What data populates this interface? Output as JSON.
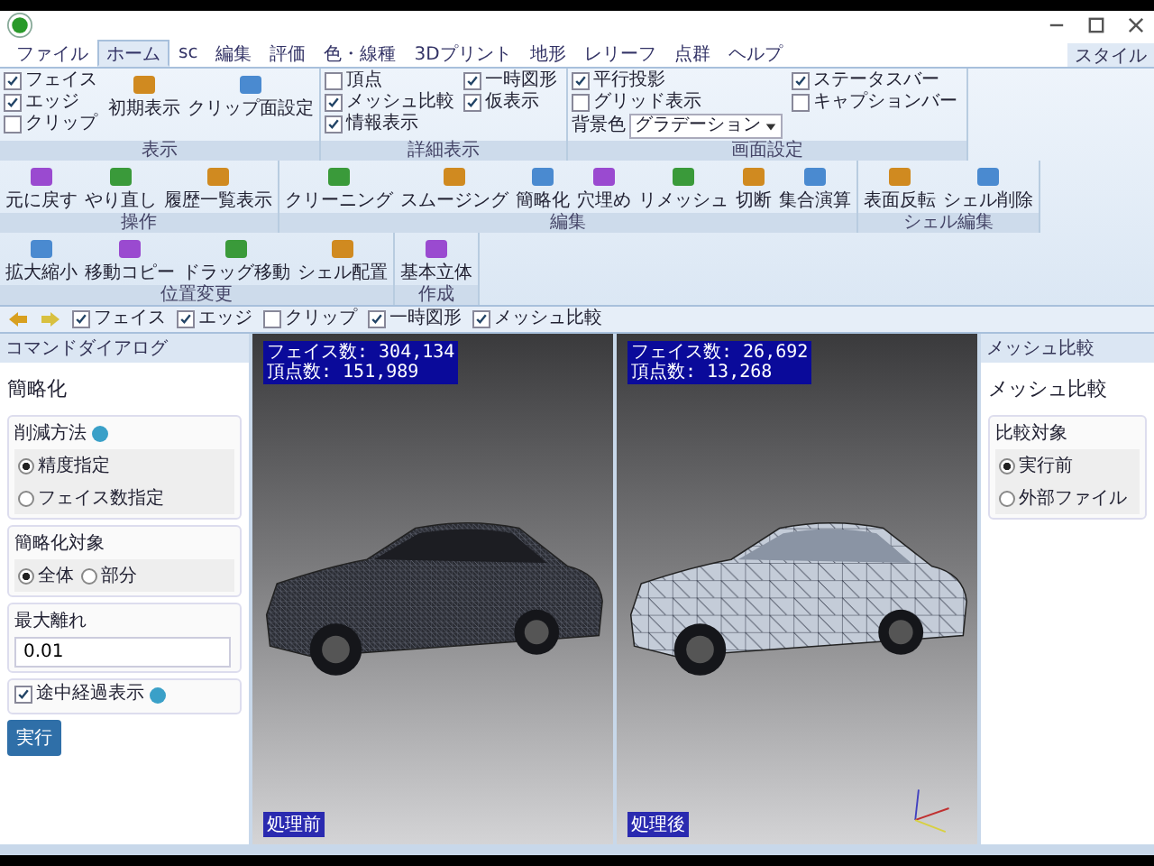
{
  "window": {
    "style_menu": "スタイル"
  },
  "tabs": [
    {
      "label": "ファイル",
      "selected": false
    },
    {
      "label": "ホーム",
      "selected": true
    },
    {
      "label": "sc",
      "selected": false
    },
    {
      "label": "編集",
      "selected": false
    },
    {
      "label": "評価",
      "selected": false
    },
    {
      "label": "色・線種",
      "selected": false
    },
    {
      "label": "3Dプリント",
      "selected": false
    },
    {
      "label": "地形",
      "selected": false
    },
    {
      "label": "レリーフ",
      "selected": false
    },
    {
      "label": "点群",
      "selected": false
    },
    {
      "label": "ヘルプ",
      "selected": false
    }
  ],
  "ribbon_groups": [
    {
      "title": "表示",
      "items": [
        {
          "kind": "check",
          "label": "フェイス",
          "checked": true
        },
        {
          "kind": "check",
          "label": "エッジ",
          "checked": true
        },
        {
          "kind": "check",
          "label": "クリップ",
          "checked": false
        },
        {
          "kind": "button",
          "label": "初期表示"
        },
        {
          "kind": "button",
          "label": "クリップ面設定"
        }
      ]
    },
    {
      "title": "詳細表示",
      "items": [
        {
          "kind": "check",
          "label": "頂点",
          "checked": false
        },
        {
          "kind": "check",
          "label": "メッシュ比較",
          "checked": true
        },
        {
          "kind": "check",
          "label": "情報表示",
          "checked": true
        },
        {
          "kind": "check",
          "label": "一時図形",
          "checked": true
        },
        {
          "kind": "check",
          "label": "仮表示",
          "checked": true
        }
      ]
    },
    {
      "title": "画面設定",
      "items": [
        {
          "kind": "check",
          "label": "平行投影",
          "checked": true
        },
        {
          "kind": "check",
          "label": "グリッド表示",
          "checked": false
        },
        {
          "kind": "select",
          "label": "背景色",
          "value": "グラデーション"
        },
        {
          "kind": "check",
          "label": "ステータスバー",
          "checked": true
        },
        {
          "kind": "check",
          "label": "キャプションバー",
          "checked": false
        }
      ]
    },
    {
      "title": "操作",
      "items": [
        {
          "kind": "button",
          "label": "元に戻す"
        },
        {
          "kind": "button",
          "label": "やり直し"
        },
        {
          "kind": "button",
          "label": "履歴一覧表示"
        }
      ]
    },
    {
      "title": "編集",
      "items": [
        {
          "kind": "button",
          "label": "クリーニング"
        },
        {
          "kind": "button",
          "label": "スムージング"
        },
        {
          "kind": "button",
          "label": "簡略化"
        },
        {
          "kind": "button",
          "label": "穴埋め"
        },
        {
          "kind": "button",
          "label": "リメッシュ"
        },
        {
          "kind": "button",
          "label": "切断"
        },
        {
          "kind": "button",
          "label": "集合演算"
        }
      ]
    },
    {
      "title": "シェル編集",
      "items": [
        {
          "kind": "button",
          "label": "表面反転"
        },
        {
          "kind": "button",
          "label": "シェル削除"
        }
      ]
    },
    {
      "title": "位置変更",
      "items": [
        {
          "kind": "button",
          "label": "拡大縮小"
        },
        {
          "kind": "button",
          "label": "移動コピー"
        },
        {
          "kind": "button",
          "label": "ドラッグ移動"
        },
        {
          "kind": "button",
          "label": "シェル配置"
        }
      ]
    },
    {
      "title": "作成",
      "items": [
        {
          "kind": "button",
          "label": "基本立体"
        }
      ]
    }
  ],
  "quick_access": [
    {
      "label": "フェイス",
      "checked": true
    },
    {
      "label": "エッジ",
      "checked": true
    },
    {
      "label": "クリップ",
      "checked": false
    },
    {
      "label": "一時図形",
      "checked": true
    },
    {
      "label": "メッシュ比較",
      "checked": true
    }
  ],
  "left_panel": {
    "header": "コマンドダイアログ",
    "title": "簡略化",
    "sections": [
      {
        "kind": "radio",
        "label": "削減方法",
        "help": true,
        "options": [
          {
            "label": "精度指定",
            "selected": true
          },
          {
            "label": "フェイス数指定",
            "selected": false
          }
        ]
      },
      {
        "kind": "radio",
        "label": "簡略化対象",
        "options": [
          {
            "label": "全体",
            "selected": true
          },
          {
            "label": "部分",
            "selected": false
          }
        ]
      },
      {
        "kind": "input",
        "label": "最大離れ",
        "value": "0.01"
      },
      {
        "kind": "check",
        "label": "途中経過表示",
        "checked": true,
        "help": true
      }
    ],
    "button": "実行"
  },
  "viewports": [
    {
      "stats": [
        "フェイス数: 304,134",
        "頂点数: 151,989"
      ],
      "caption": "処理前",
      "kind": "dense"
    },
    {
      "stats": [
        "フェイス数: 26,692",
        "頂点数: 13,268"
      ],
      "caption": "処理後",
      "kind": "coarse",
      "axes": true
    }
  ],
  "right_panel": {
    "header": "メッシュ比較",
    "title": "メッシュ比較",
    "sections": [
      {
        "kind": "radio",
        "label": "比較対象",
        "options": [
          {
            "label": "実行前",
            "selected": true
          },
          {
            "label": "外部ファイル",
            "selected": false
          }
        ]
      }
    ]
  }
}
